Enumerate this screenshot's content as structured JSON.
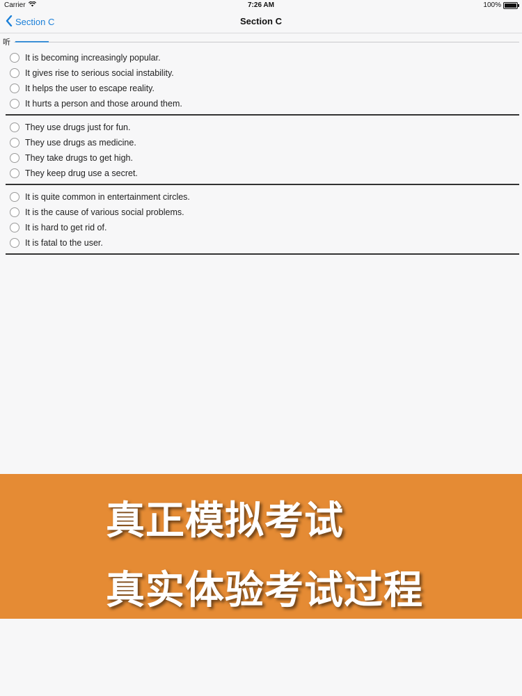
{
  "status_bar": {
    "carrier": "Carrier",
    "time": "7:26 AM",
    "battery": "100%"
  },
  "nav": {
    "back_label": "Section C",
    "title": "Section C"
  },
  "tab": {
    "label": "听"
  },
  "question_groups": [
    {
      "options": [
        "It is becoming increasingly popular.",
        "It gives rise to serious social instability.",
        "It helps the user to escape reality.",
        "It hurts a person and those around them."
      ]
    },
    {
      "options": [
        "They use drugs just for fun.",
        "They use drugs as medicine.",
        "They take drugs to get high.",
        "They keep drug use a secret."
      ]
    },
    {
      "options": [
        "It is quite common in entertainment circles.",
        "It is the cause of various social problems.",
        "It is hard to get rid of.",
        "It is fatal to the user."
      ]
    }
  ],
  "banner": {
    "line1": "真正模拟考试",
    "line2": "真实体验考试过程",
    "color": "#e58b34"
  },
  "colors": {
    "accent": "#1a7fd8",
    "tab_indicator": "#3a8fd6"
  },
  "icons": {
    "back": "chevron-left-icon",
    "wifi": "wifi-icon",
    "battery": "battery-icon",
    "radio": "radio-button-icon"
  }
}
